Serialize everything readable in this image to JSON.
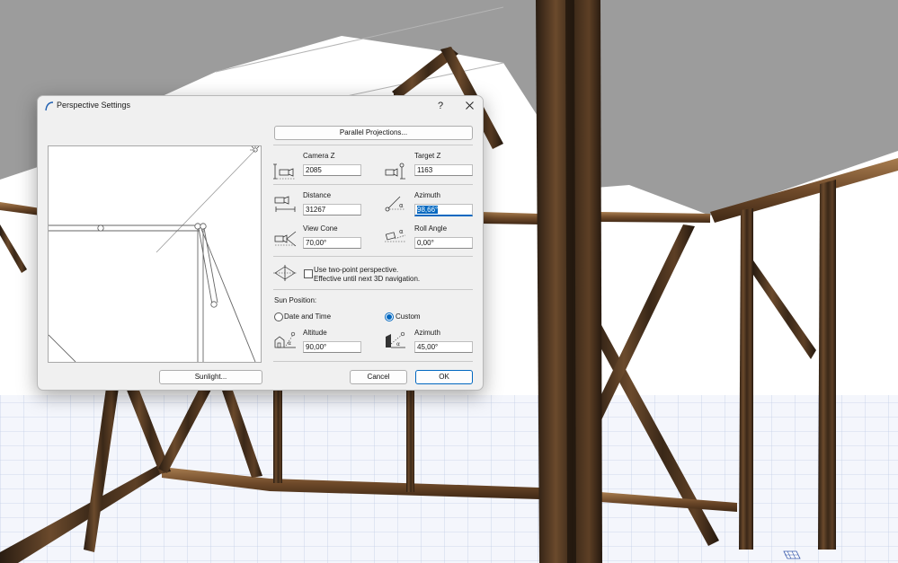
{
  "dialog": {
    "title": "Perspective Settings",
    "help_label": "?",
    "parallel_projections_label": "Parallel Projections...",
    "camera_z": {
      "label": "Camera Z",
      "value": "2085"
    },
    "target_z": {
      "label": "Target Z",
      "value": "1163"
    },
    "distance": {
      "label": "Distance",
      "value": "31267"
    },
    "azimuth": {
      "label": "Azimuth",
      "value": "98,66°"
    },
    "view_cone": {
      "label": "View Cone",
      "value": "70,00°"
    },
    "roll_angle": {
      "label": "Roll Angle",
      "value": "0,00°"
    },
    "two_point": {
      "line1": "Use two-point perspective.",
      "line2": "Effective until next 3D navigation.",
      "checked": false
    },
    "sun_position": {
      "heading": "Sun Position:",
      "option_date": "Date and Time",
      "option_custom": "Custom",
      "selected": "Custom",
      "altitude": {
        "label": "Altitude",
        "value": "90,00°"
      },
      "azimuth": {
        "label": "Azimuth",
        "value": "45,00°"
      }
    },
    "sunlight_label": "Sunlight...",
    "cancel_label": "Cancel",
    "ok_label": "OK"
  },
  "colors": {
    "accent": "#0067c0",
    "dialog_bg": "#f0f0f0",
    "canopy": "#9c9c9c",
    "wood": "#7a5533",
    "floor_grid": "#c3cee6"
  },
  "icons": [
    "archicad-icon",
    "close-icon",
    "camera-height-icon",
    "target-height-icon",
    "distance-icon",
    "azimuth-icon",
    "view-cone-icon",
    "roll-angle-icon",
    "two-point-perspective-icon",
    "sun-altitude-icon",
    "sun-azimuth-icon",
    "navigator-grid-icon"
  ]
}
